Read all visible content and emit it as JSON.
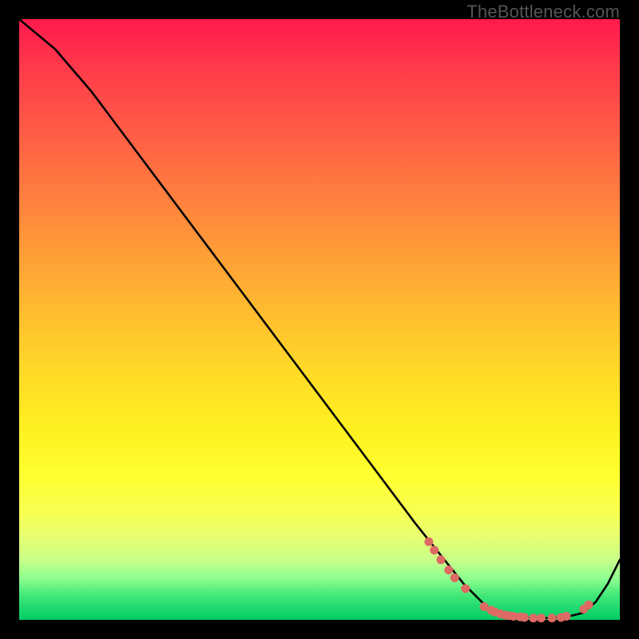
{
  "watermark": "TheBottleneck.com",
  "chart_data": {
    "type": "line",
    "title": "",
    "xlabel": "",
    "ylabel": "",
    "xlim": [
      0,
      100
    ],
    "ylim": [
      0,
      100
    ],
    "series": [
      {
        "name": "curve",
        "x": [
          0,
          6,
          12,
          18,
          24,
          30,
          36,
          42,
          48,
          54,
          60,
          66,
          70,
          74,
          76,
          78,
          80,
          82,
          84,
          86,
          88,
          90,
          92,
          94,
          96,
          98,
          100
        ],
        "y": [
          100,
          95,
          88,
          80,
          72,
          64,
          56,
          48,
          40,
          32,
          24,
          16,
          11,
          6,
          4,
          2,
          1,
          0.6,
          0.4,
          0.3,
          0.3,
          0.4,
          0.7,
          1.2,
          3,
          6,
          10
        ]
      }
    ],
    "markers": [
      {
        "x": 68.2,
        "y": 13.0
      },
      {
        "x": 69.1,
        "y": 11.6
      },
      {
        "x": 70.2,
        "y": 10.0
      },
      {
        "x": 71.5,
        "y": 8.3
      },
      {
        "x": 72.5,
        "y": 7.0
      },
      {
        "x": 74.3,
        "y": 5.2
      },
      {
        "x": 77.4,
        "y": 2.2
      },
      {
        "x": 78.6,
        "y": 1.6
      },
      {
        "x": 79.2,
        "y": 1.3
      },
      {
        "x": 80.1,
        "y": 1.0
      },
      {
        "x": 80.9,
        "y": 0.8
      },
      {
        "x": 81.5,
        "y": 0.7
      },
      {
        "x": 82.3,
        "y": 0.6
      },
      {
        "x": 83.4,
        "y": 0.5
      },
      {
        "x": 84.1,
        "y": 0.4
      },
      {
        "x": 85.6,
        "y": 0.3
      },
      {
        "x": 86.9,
        "y": 0.3
      },
      {
        "x": 88.7,
        "y": 0.3
      },
      {
        "x": 90.2,
        "y": 0.4
      },
      {
        "x": 91.1,
        "y": 0.6
      },
      {
        "x": 94.0,
        "y": 1.8
      },
      {
        "x": 94.8,
        "y": 2.5
      }
    ]
  }
}
